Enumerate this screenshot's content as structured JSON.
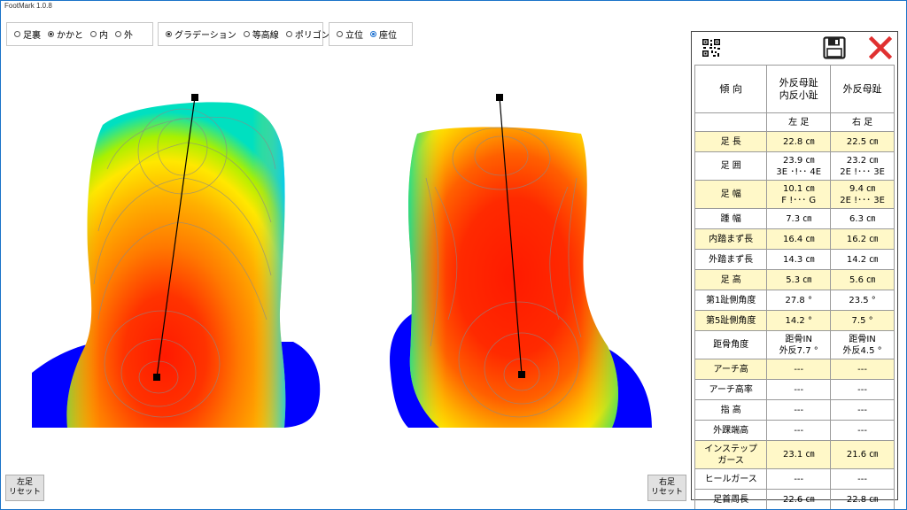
{
  "window": {
    "title": "FootMark 1.0.8"
  },
  "view_options": {
    "sole_area": [
      {
        "label": "足裏",
        "selected": false
      },
      {
        "label": "かかと",
        "selected": true
      },
      {
        "label": "内",
        "selected": false
      },
      {
        "label": "外",
        "selected": false
      }
    ],
    "display_mode": [
      {
        "label": "グラデーション",
        "selected": true
      },
      {
        "label": "等高線",
        "selected": false
      },
      {
        "label": "ポリゴン",
        "selected": false
      }
    ],
    "posture": [
      {
        "label": "立位",
        "selected": false
      },
      {
        "label": "座位",
        "selected": true
      }
    ]
  },
  "buttons": {
    "left_reset_line1": "左足",
    "left_reset_line2": "リセット",
    "right_reset_line1": "右足",
    "right_reset_line2": "リセット"
  },
  "icons": {
    "qr": "qr-code-icon",
    "save": "floppy-disk-icon",
    "close": "close-x-icon"
  },
  "colors": {
    "close_red": "#e03030",
    "yellow_row": "#fff8c8",
    "radio_blue": "#1a6fd0",
    "floor_blue": "#0000ff"
  },
  "table": {
    "tendency_label": "傾 向",
    "tendency_left_line1": "外反母趾",
    "tendency_left_line2": "内反小趾",
    "tendency_right": "外反母趾",
    "col_left": "左 足",
    "col_right": "右 足",
    "rows": [
      {
        "label": "足 長",
        "left": "22.8 ㎝",
        "right": "22.5 ㎝",
        "left2": "",
        "right2": ""
      },
      {
        "label": "足 囲",
        "left": "23.9 ㎝",
        "right": "23.2 ㎝",
        "left2": "3E ･!･･ 4E",
        "right2": "2E !･･･ 3E"
      },
      {
        "label": "足 幅",
        "left": "10.1 ㎝",
        "right": "9.4 ㎝",
        "left2": "F !･･･ G",
        "right2": "2E !･･･ 3E"
      },
      {
        "label": "踵 幅",
        "left": "7.3 ㎝",
        "right": "6.3 ㎝",
        "left2": "",
        "right2": ""
      },
      {
        "label": "内踏まず長",
        "left": "16.4 ㎝",
        "right": "16.2 ㎝",
        "left2": "",
        "right2": ""
      },
      {
        "label": "外踏まず長",
        "left": "14.3 ㎝",
        "right": "14.2 ㎝",
        "left2": "",
        "right2": ""
      },
      {
        "label": "足 高",
        "left": "5.3 ㎝",
        "right": "5.6 ㎝",
        "left2": "",
        "right2": ""
      },
      {
        "label": "第1趾側角度",
        "left": "27.8 °",
        "right": "23.5 °",
        "left2": "",
        "right2": ""
      },
      {
        "label": "第5趾側角度",
        "left": "14.2 °",
        "right": "7.5 °",
        "left2": "",
        "right2": ""
      },
      {
        "label": "距骨角度",
        "left": "距骨IN",
        "right": "距骨IN",
        "left2": "外反7.7 °",
        "right2": "外反4.5 °"
      },
      {
        "label": "アーチ高",
        "left": "---",
        "right": "---",
        "left2": "",
        "right2": ""
      },
      {
        "label": "アーチ高率",
        "left": "---",
        "right": "---",
        "left2": "",
        "right2": ""
      },
      {
        "label": "指 高",
        "left": "---",
        "right": "---",
        "left2": "",
        "right2": ""
      },
      {
        "label": "外踝端高",
        "left": "---",
        "right": "---",
        "left2": "",
        "right2": ""
      },
      {
        "label": "インステップ",
        "label2": "ガース",
        "left": "23.1 ㎝",
        "right": "21.6 ㎝",
        "left2": "",
        "right2": ""
      },
      {
        "label": "ヒールガース",
        "left": "---",
        "right": "---",
        "left2": "",
        "right2": ""
      },
      {
        "label": "足首周長",
        "left": "22.6 ㎝",
        "right": "22.8 ㎝",
        "left2": "",
        "right2": ""
      }
    ]
  }
}
